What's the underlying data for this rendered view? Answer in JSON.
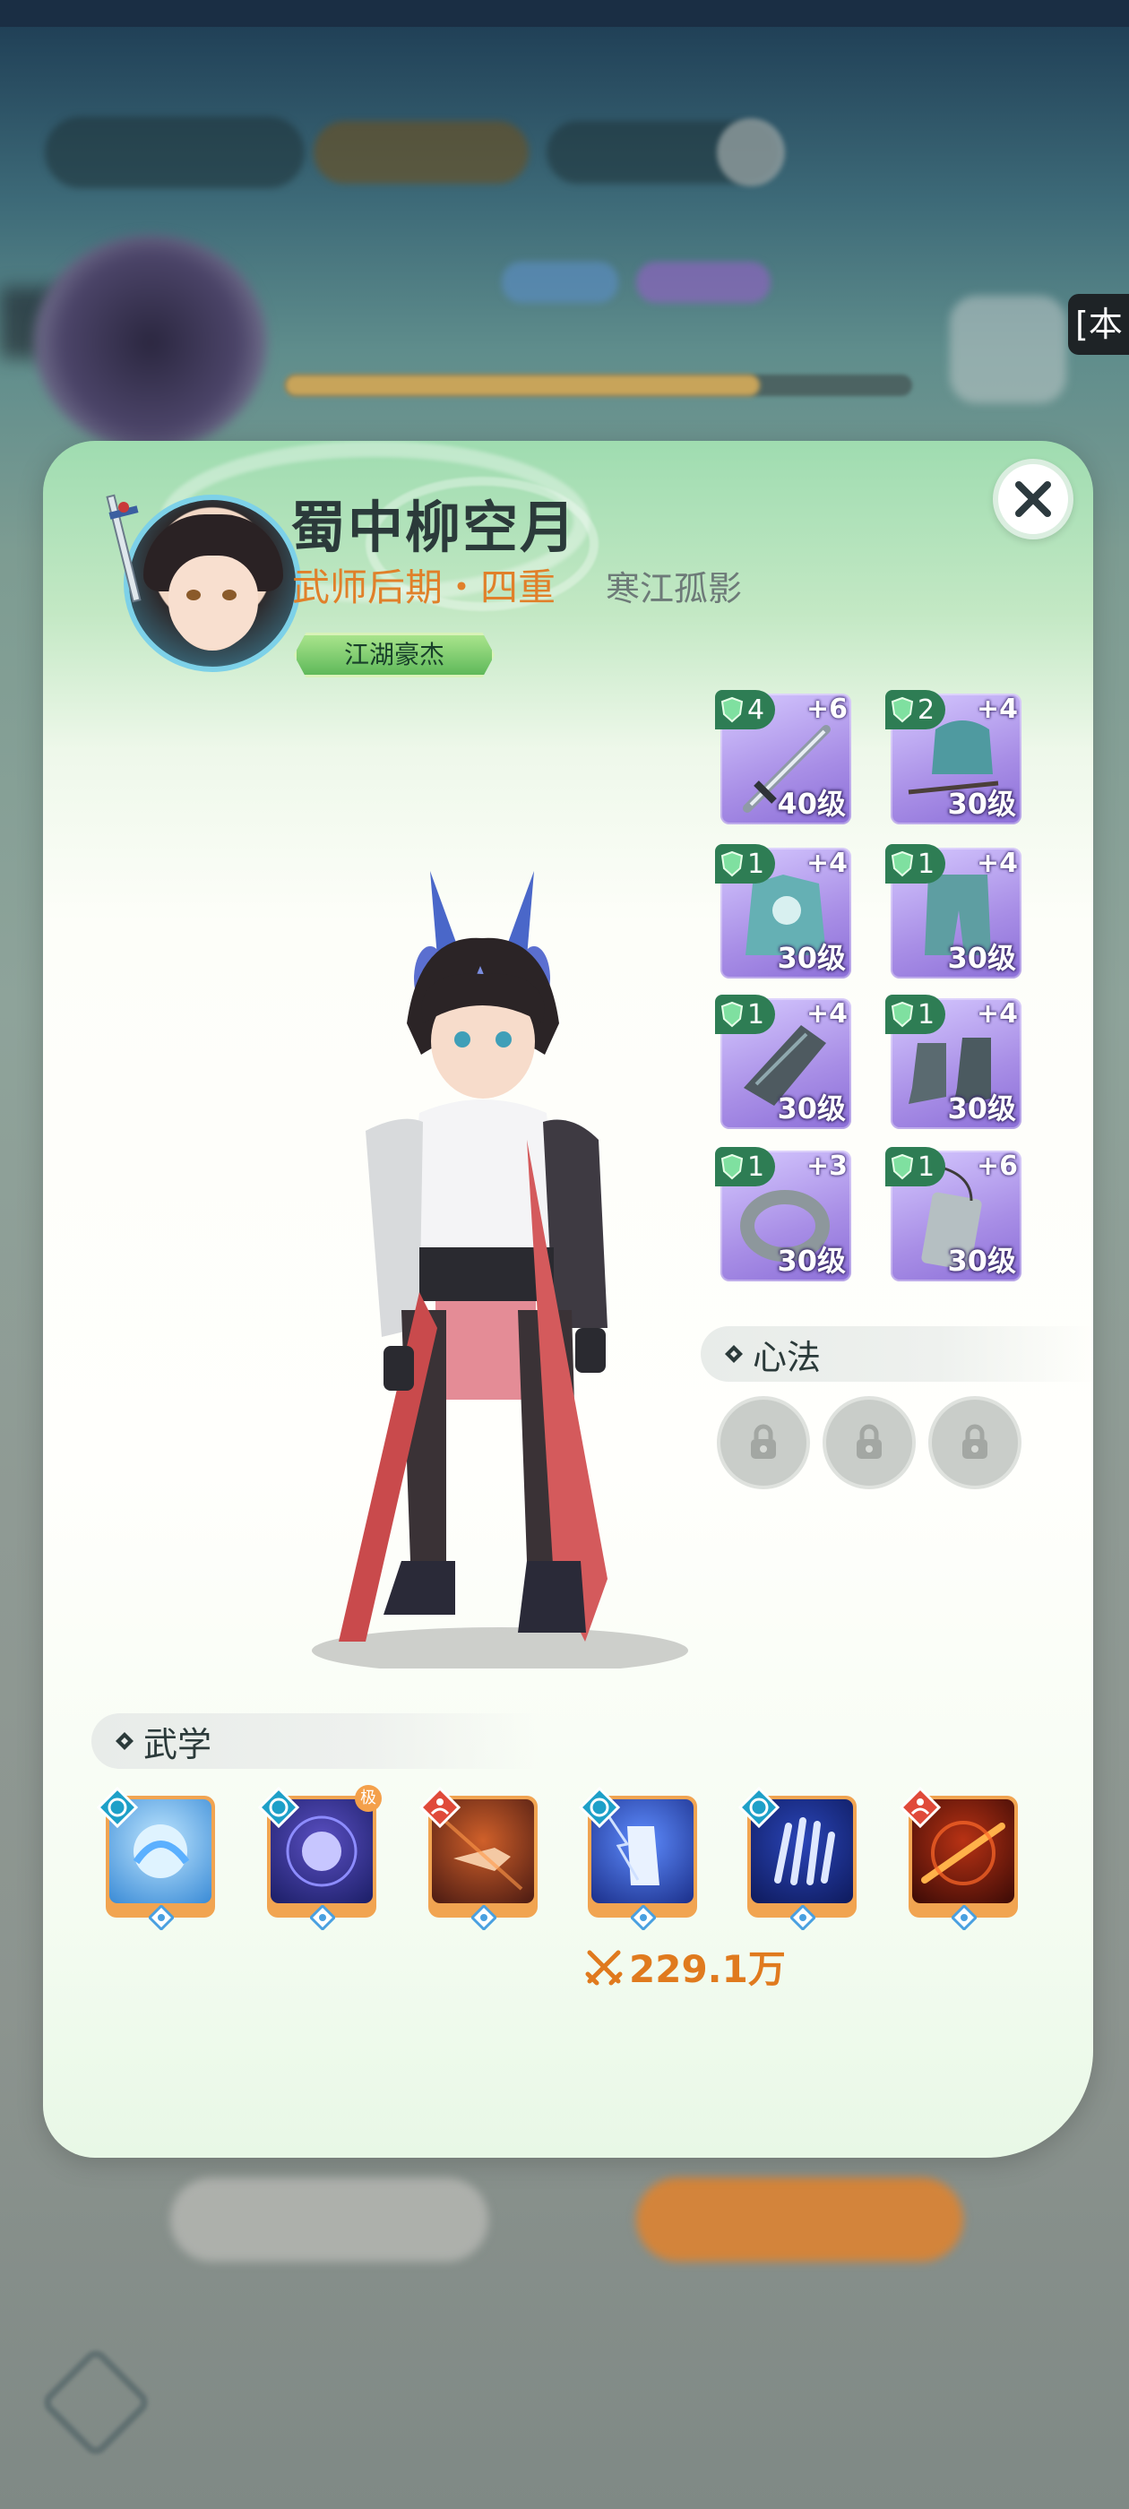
{
  "edge_tag": "[本",
  "character": {
    "name": "蜀中柳空月",
    "rank": "武师后期・四重",
    "guild": "寒江孤影",
    "title_badge": "江湖豪杰"
  },
  "equipment": [
    {
      "slot": "weapon",
      "icon": "sword-icon",
      "gem": "4",
      "refine": "+6",
      "level": "40级"
    },
    {
      "slot": "head",
      "icon": "hood-icon",
      "gem": "2",
      "refine": "+4",
      "level": "30级"
    },
    {
      "slot": "top",
      "icon": "robe-icon",
      "gem": "1",
      "refine": "+4",
      "level": "30级"
    },
    {
      "slot": "bottom",
      "icon": "pants-icon",
      "gem": "1",
      "refine": "+4",
      "level": "30级"
    },
    {
      "slot": "bracer",
      "icon": "bracer-icon",
      "gem": "1",
      "refine": "+4",
      "level": "30级"
    },
    {
      "slot": "boots",
      "icon": "boots-icon",
      "gem": "1",
      "refine": "+4",
      "level": "30级"
    },
    {
      "slot": "ring",
      "icon": "ring-icon",
      "gem": "1",
      "refine": "+3",
      "level": "30级"
    },
    {
      "slot": "pendant",
      "icon": "pendant-icon",
      "gem": "1",
      "refine": "+6",
      "level": "30级"
    }
  ],
  "xinfa": {
    "label": "心法",
    "slots": [
      "locked",
      "locked",
      "locked"
    ]
  },
  "wuxue": {
    "label": "武学",
    "skills": [
      {
        "icon": "fist-palm-icon",
        "school": "taiji"
      },
      {
        "icon": "spirit-orb-icon",
        "school": "taiji",
        "corner": "极"
      },
      {
        "icon": "punch-icon",
        "school": "meditation"
      },
      {
        "icon": "lightning-palm-icon",
        "school": "taiji"
      },
      {
        "icon": "claw-icon",
        "school": "taiji"
      },
      {
        "icon": "fire-staff-icon",
        "school": "meditation"
      }
    ]
  },
  "power": "229.1万",
  "colors": {
    "accent_orange": "#e0802a",
    "equip_purple": "#a88ee6",
    "gem_green": "#2e7d54"
  }
}
